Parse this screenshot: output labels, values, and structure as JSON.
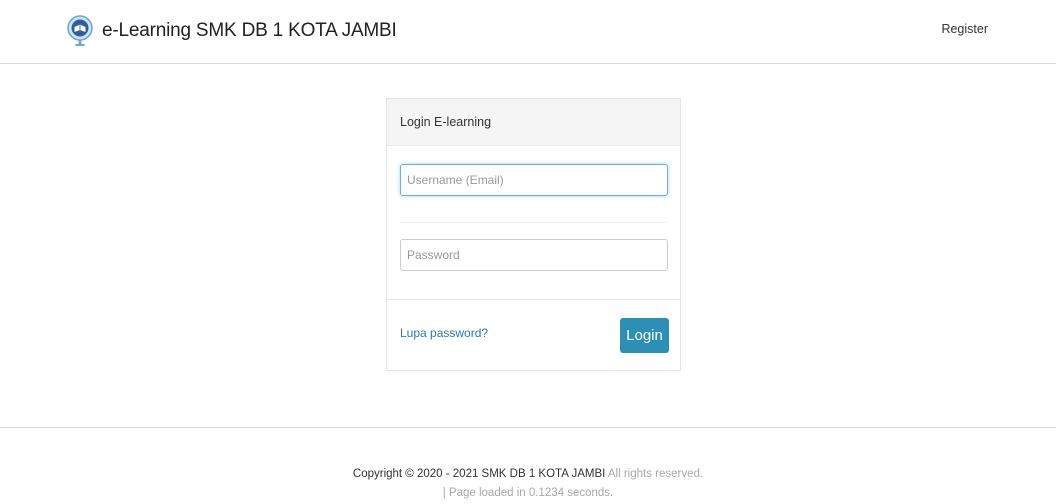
{
  "header": {
    "title": "e-Learning SMK DB 1 KOTA JAMBI",
    "logo_icon": "globe-book-logo-icon",
    "register_label": "Register"
  },
  "login": {
    "heading": "Login E-learning",
    "username_placeholder": "Username (Email)",
    "username_value": "",
    "password_placeholder": "Password",
    "password_value": "",
    "forgot_label": "Lupa password?",
    "submit_label": "Login"
  },
  "footer": {
    "copyright_main": "Copyright © 2020 - 2021 SMK DB 1 KOTA JAMBI",
    "copyright_suffix": " All rights reserved.",
    "load_time": "| Page loaded in 0.1234 seconds."
  },
  "colors": {
    "accent": "#2b8fb6",
    "link": "#2a7ab0",
    "focus_border": "#66afe9",
    "heading_bg": "#f5f5f5"
  }
}
